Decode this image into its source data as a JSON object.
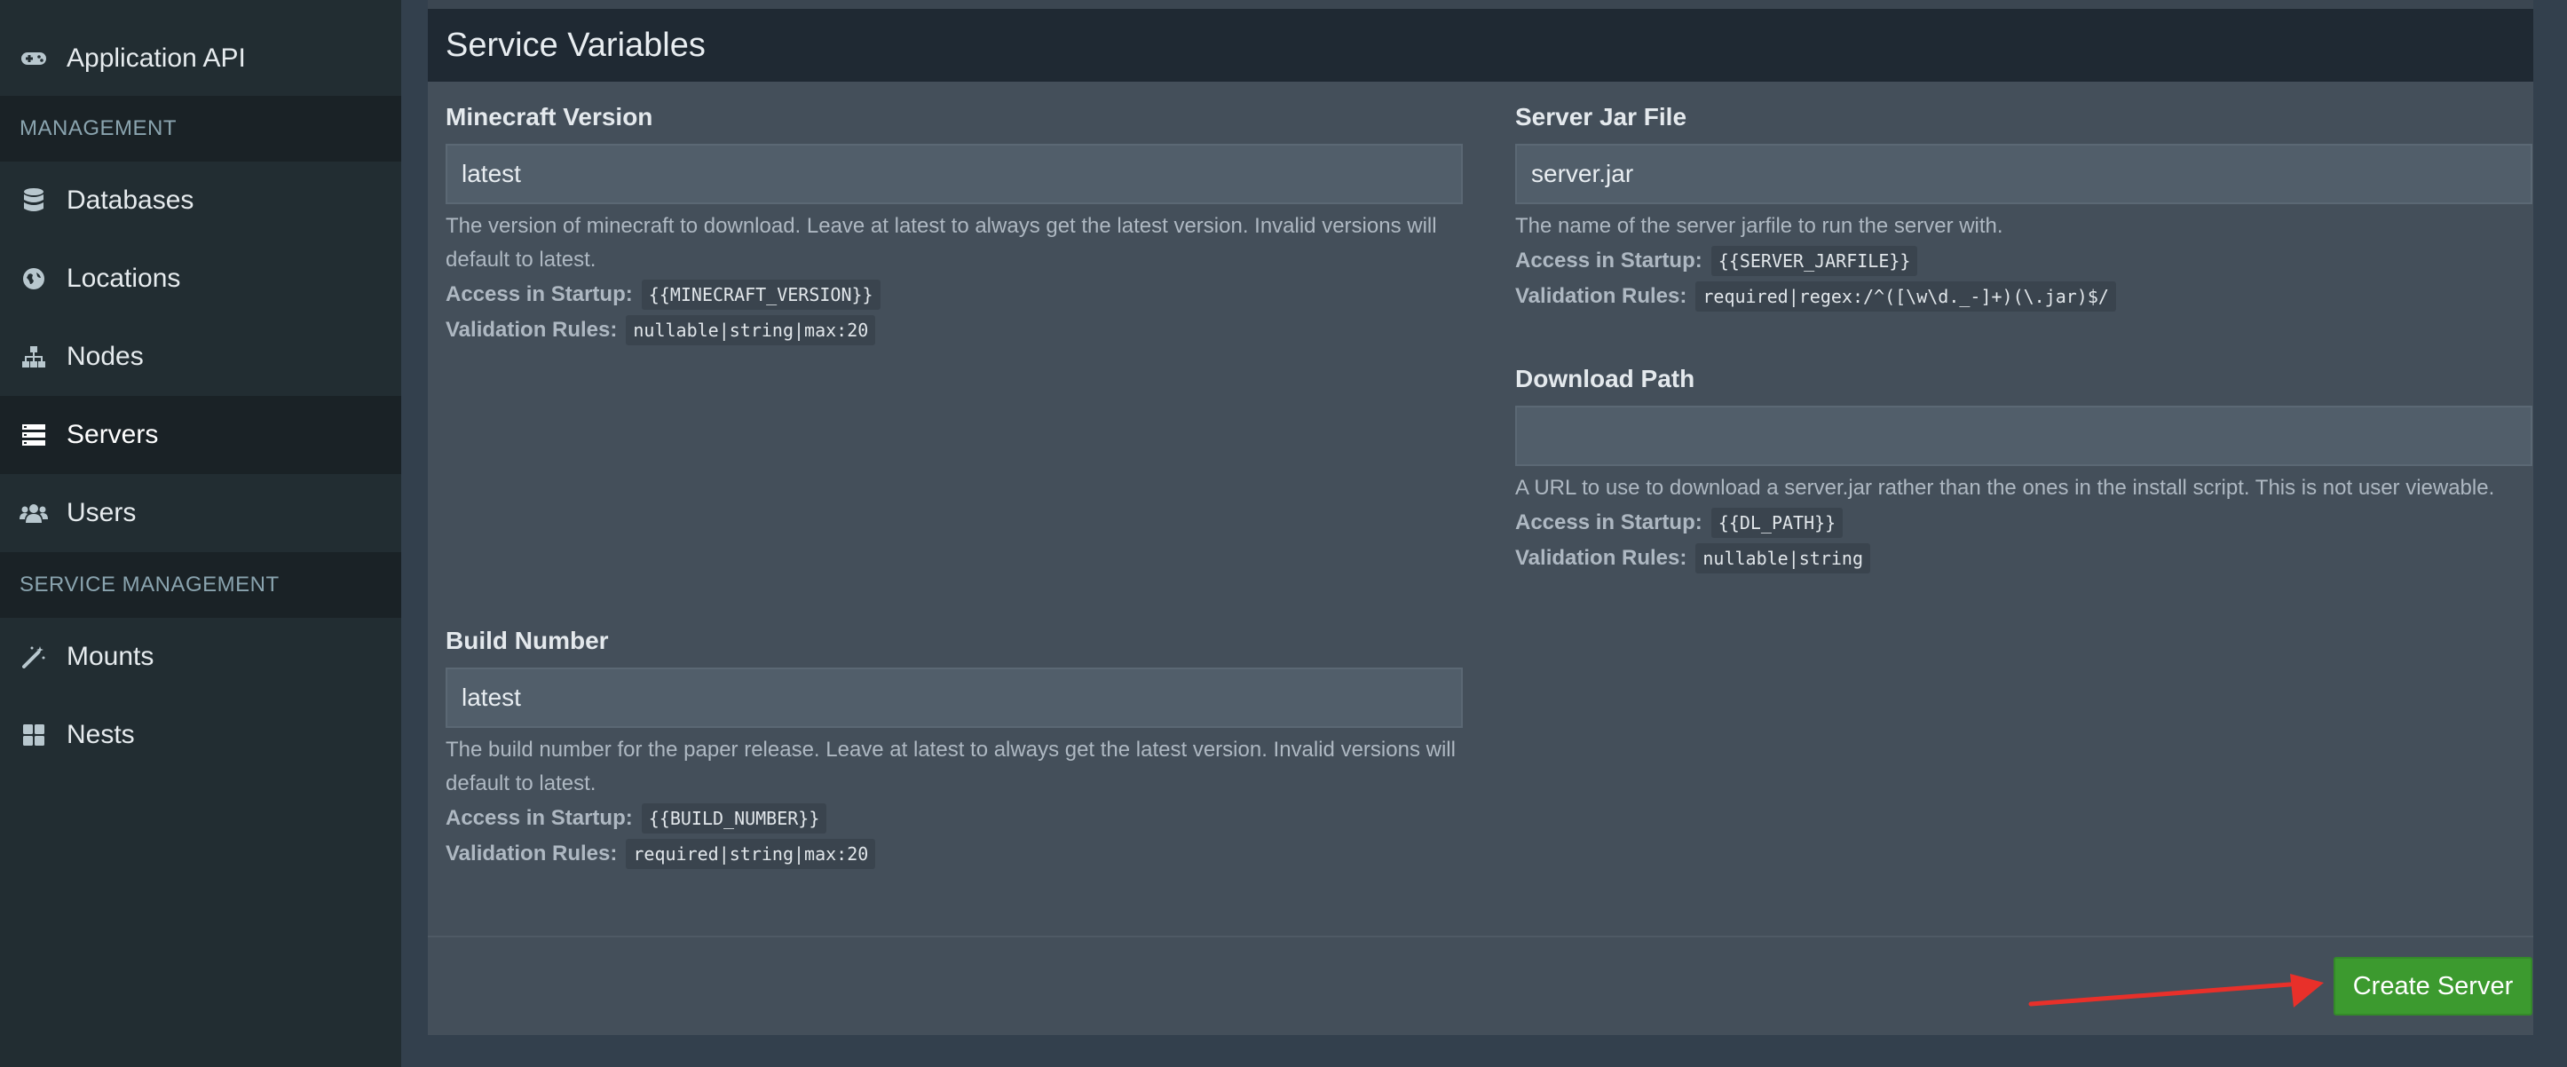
{
  "sidebar": {
    "items_top": [
      {
        "label": "Application API",
        "icon": "gamepad-icon"
      }
    ],
    "management_header": "MANAGEMENT",
    "management_items": [
      {
        "label": "Databases",
        "icon": "database-icon"
      },
      {
        "label": "Locations",
        "icon": "globe-icon"
      },
      {
        "label": "Nodes",
        "icon": "sitemap-icon"
      },
      {
        "label": "Servers",
        "icon": "server-icon",
        "active": true
      },
      {
        "label": "Users",
        "icon": "users-icon"
      }
    ],
    "service_header": "SERVICE MANAGEMENT",
    "service_items": [
      {
        "label": "Mounts",
        "icon": "magic-icon"
      },
      {
        "label": "Nests",
        "icon": "th-large-icon"
      }
    ]
  },
  "box": {
    "title": "Service Variables",
    "access_label": "Access in Startup:",
    "validation_label": "Validation Rules:",
    "fields": {
      "minecraft_version": {
        "label": "Minecraft Version",
        "value": "latest",
        "description": "The version of minecraft to download. Leave at latest to always get the latest version. Invalid versions will default to latest.",
        "startup": "{{MINECRAFT_VERSION}}",
        "rules": "nullable|string|max:20"
      },
      "server_jar": {
        "label": "Server Jar File",
        "value": "server.jar",
        "description": "The name of the server jarfile to run the server with.",
        "startup": "{{SERVER_JARFILE}}",
        "rules": "required|regex:/^([\\w\\d._-]+)(\\.jar)$/"
      },
      "download_path": {
        "label": "Download Path",
        "value": "",
        "description": "A URL to use to download a server.jar rather than the ones in the install script. This is not user viewable.",
        "startup": "{{DL_PATH}}",
        "rules": "nullable|string"
      },
      "build_number": {
        "label": "Build Number",
        "value": "latest",
        "description": "The build number for the paper release. Leave at latest to always get the latest version. Invalid versions will default to latest.",
        "startup": "{{BUILD_NUMBER}}",
        "rules": "required|string|max:20"
      }
    },
    "create_button": "Create Server"
  },
  "colors": {
    "sidebar_bg": "#222d32",
    "box_bg": "#444f5a",
    "header_bg": "#1f2933",
    "button_green": "#3c9a2f",
    "arrow_red": "#e8302a"
  }
}
